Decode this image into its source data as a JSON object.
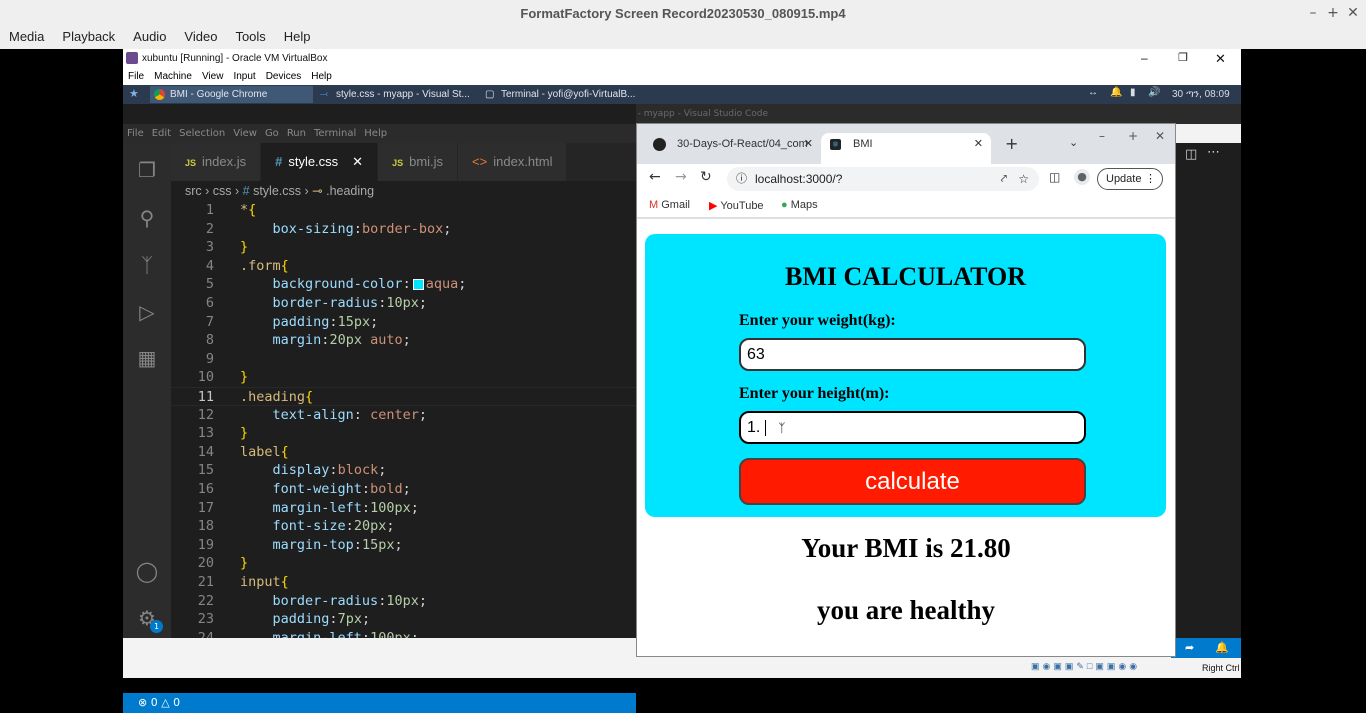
{
  "player": {
    "title": "FormatFactory Screen Record20230530_080915.mp4",
    "menu": [
      "Media",
      "Playback",
      "Audio",
      "Video",
      "Tools",
      "Help"
    ]
  },
  "vbox": {
    "title": "xubuntu [Running] - Oracle VM VirtualBox",
    "menu": [
      "File",
      "Machine",
      "View",
      "Input",
      "Devices",
      "Help"
    ],
    "status_right": "Right Ctrl"
  },
  "xfce": {
    "tasks": [
      "BMI - Google Chrome",
      "style.css - myapp - Visual St...",
      "Terminal - yofi@yofi-VirtualB..."
    ],
    "clock": "30 ጣን, 08:09"
  },
  "vscode": {
    "window_title": "style.css - myapp - Visual Studio Code",
    "menu": [
      "File",
      "Edit",
      "Selection",
      "View",
      "Go",
      "Run",
      "Terminal",
      "Help"
    ],
    "tabs": [
      "index.js",
      "style.css",
      "bmi.js",
      "index.html"
    ],
    "breadcrumb": {
      "p1": "src",
      "p2": "css",
      "p3": "style.css",
      "p4": ".heading"
    },
    "status": {
      "errors": "0",
      "warnings": "0"
    },
    "badge": "1"
  },
  "chrome": {
    "tabs": [
      "30-Days-Of-React/04_com",
      "BMI"
    ],
    "url": "localhost:3000/?",
    "update_label": "Update",
    "bookmarks": [
      "Gmail",
      "YouTube",
      "Maps"
    ]
  },
  "app": {
    "heading": "BMI CALCULATOR",
    "weight_label": "Enter your weight(kg):",
    "weight_value": "63",
    "height_label": "Enter your height(m):",
    "height_value": "1.",
    "button_label": "calculate",
    "result_text": "Your BMI is 21.80",
    "status_text": "you are healthy"
  },
  "colors": {
    "aqua": "#00e5ff",
    "button": "#ff1a00",
    "vscode_status": "#007acc"
  }
}
